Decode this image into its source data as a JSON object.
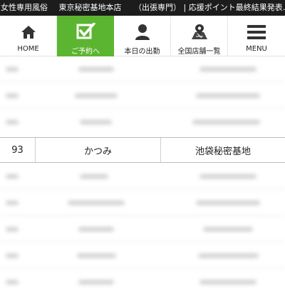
{
  "topbar": {
    "brand": "女性専用風俗",
    "store": "東京秘密基地本店",
    "ticker": "（出張専門） | 応援ポイント最終結果発表…"
  },
  "nav": {
    "home": {
      "label": "HOME",
      "icon": "home-icon"
    },
    "reserve": {
      "label": "ご予約へ",
      "icon": "checkbox-icon"
    },
    "today": {
      "label": "本日の出勤",
      "icon": "person-icon"
    },
    "stores": {
      "label": "全国店舗一覧",
      "icon": "map-icon"
    },
    "menu": {
      "label": "MENU",
      "icon": "hamburger-icon"
    },
    "active_color": "#5cb531"
  },
  "table": {
    "visible_row": {
      "number": "93",
      "name": "かつみ",
      "store": "池袋秘密基地"
    }
  }
}
